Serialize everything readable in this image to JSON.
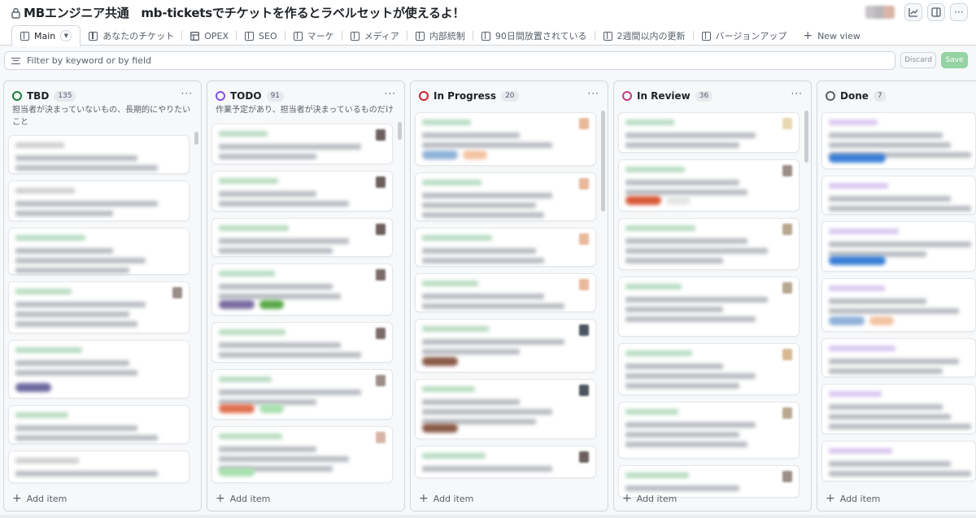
{
  "header": {
    "title": "MBエンジニア共通　mb-ticketsでチケットを作るとラベルセットが使えるよ！"
  },
  "tabs": [
    {
      "label": "Main",
      "active": true,
      "icon": "board-icon"
    },
    {
      "label": "あなたのチケット",
      "icon": "board-icon"
    },
    {
      "label": "OPEX",
      "icon": "table-icon"
    },
    {
      "label": "SEO",
      "icon": "board-icon"
    },
    {
      "label": "マーケ",
      "icon": "board-icon"
    },
    {
      "label": "メディア",
      "icon": "board-icon"
    },
    {
      "label": "内部統制",
      "icon": "board-icon"
    },
    {
      "label": "90日間放置されている",
      "icon": "board-icon"
    },
    {
      "label": "2週間以内の更新",
      "icon": "board-icon"
    },
    {
      "label": "バージョンアップ",
      "icon": "board-icon"
    },
    {
      "label": "New view",
      "icon": "plus-icon"
    }
  ],
  "filter": {
    "placeholder": "Filter by keyword or by field",
    "discard_label": "Discard",
    "save_label": "Save"
  },
  "columns": [
    {
      "name": "TBD",
      "count": "135",
      "color": "#1a7f37",
      "description": "担当者が決まっていないもの、長期的にやりたいこと",
      "add_label": "Add item"
    },
    {
      "name": "TODO",
      "count": "91",
      "color": "#8250df",
      "description": "作業予定があり、担当者が決まっているものだけ",
      "add_label": "Add item"
    },
    {
      "name": "In Progress",
      "count": "20",
      "color": "#cf222e",
      "description": "",
      "add_label": "Add item"
    },
    {
      "name": "In Review",
      "count": "36",
      "color": "#bf3989",
      "description": "",
      "add_label": "Add item"
    },
    {
      "name": "Done",
      "count": "7",
      "color": "#57606a",
      "description": "",
      "add_label": "Add item"
    }
  ],
  "colors": {
    "accent_green": "#94d3a2",
    "border": "#d0d7de"
  }
}
